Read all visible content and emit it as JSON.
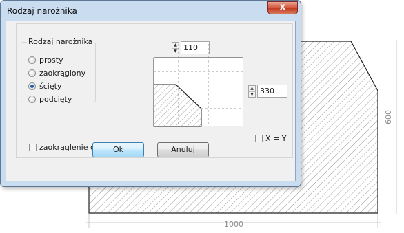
{
  "dialog": {
    "title": "Rodzaj narożnika",
    "close_glyph": "x",
    "group_label": "Rodzaj narożnika",
    "options": [
      {
        "label": "prosty",
        "selected": false
      },
      {
        "label": "zaokrąglony",
        "selected": false
      },
      {
        "label": "ścięty",
        "selected": true
      },
      {
        "label": "podcięty",
        "selected": false
      }
    ],
    "top_value": "110",
    "side_value": "330",
    "xy_label": "X = Y",
    "round_whole_side_label": "zaokrąglenie całego boku",
    "ok_label": "Ok",
    "cancel_label": "Anuluj"
  },
  "drawing": {
    "width_label": "1000",
    "height_label": "600"
  },
  "colors": {
    "accent": "#1d5fa6",
    "frame": "#c9dcf0"
  }
}
